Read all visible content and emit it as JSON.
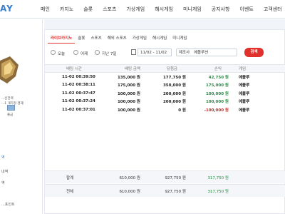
{
  "logo": "AY",
  "nav": [
    "메인",
    "카지노",
    "슬롯",
    "스포츠",
    "가상게임",
    "해시게임",
    "미니게임",
    "공지사항",
    "이벤트",
    "고객센터"
  ],
  "sidebar": {
    "line1": "...신전력",
    "line2": "...1 개가정 경괘",
    "icon_label": "출금",
    "menu": [
      "역",
      "내역",
      "역",
      "...포인트"
    ]
  },
  "tabs": [
    "라이브카지노",
    "슬롯",
    "스포츠",
    "해외 스포츠",
    "가상게임",
    "해시게임",
    "미니게임"
  ],
  "active_tab": "라이브카지노",
  "filter": {
    "options": [
      "오늘",
      "어제",
      "지난 7일"
    ],
    "date_range": "11/02 - 11/02",
    "field_label": "제조사",
    "field_value": "에볼루션",
    "search_label": "검색"
  },
  "table": {
    "headers": [
      "배팅 시간",
      "배팅 금액",
      "당첨금",
      "손익",
      "게임"
    ],
    "rows": [
      {
        "time": "11-02 00:39:50",
        "bet": "135,000 원",
        "win": "177,750 원",
        "pnl": "42,750 원",
        "sign": "pos",
        "game": "에볼루"
      },
      {
        "time": "11-02 00:38:11",
        "bet": "175,000 원",
        "win": "350,000 원",
        "pnl": "175,000 원",
        "sign": "pos",
        "game": "에볼루"
      },
      {
        "time": "11-02 00:37:47",
        "bet": "100,000 원",
        "win": "200,000 원",
        "pnl": "100,000 원",
        "sign": "pos",
        "game": "에볼루"
      },
      {
        "time": "11-02 00:37:24",
        "bet": "100,000 원",
        "win": "200,000 원",
        "pnl": "100,000 원",
        "sign": "pos",
        "game": "에볼루"
      },
      {
        "time": "11-02 00:37:01",
        "bet": "100,000 원",
        "win": "0 원",
        "pnl": "-100,000 원",
        "sign": "neg",
        "game": "에볼루"
      }
    ],
    "summary": [
      {
        "label": "합계",
        "bet": "610,000 원",
        "win": "927,750 원",
        "pnl": "317,750 원"
      },
      {
        "label": "전체",
        "bet": "610,000 원",
        "win": "927,750 원",
        "pnl": "317,750 원"
      }
    ]
  },
  "colors": {
    "accent": "#e0312c",
    "positive": "#1e8f3e",
    "negative": "#d9231f",
    "brand": "#3a7fd0"
  }
}
